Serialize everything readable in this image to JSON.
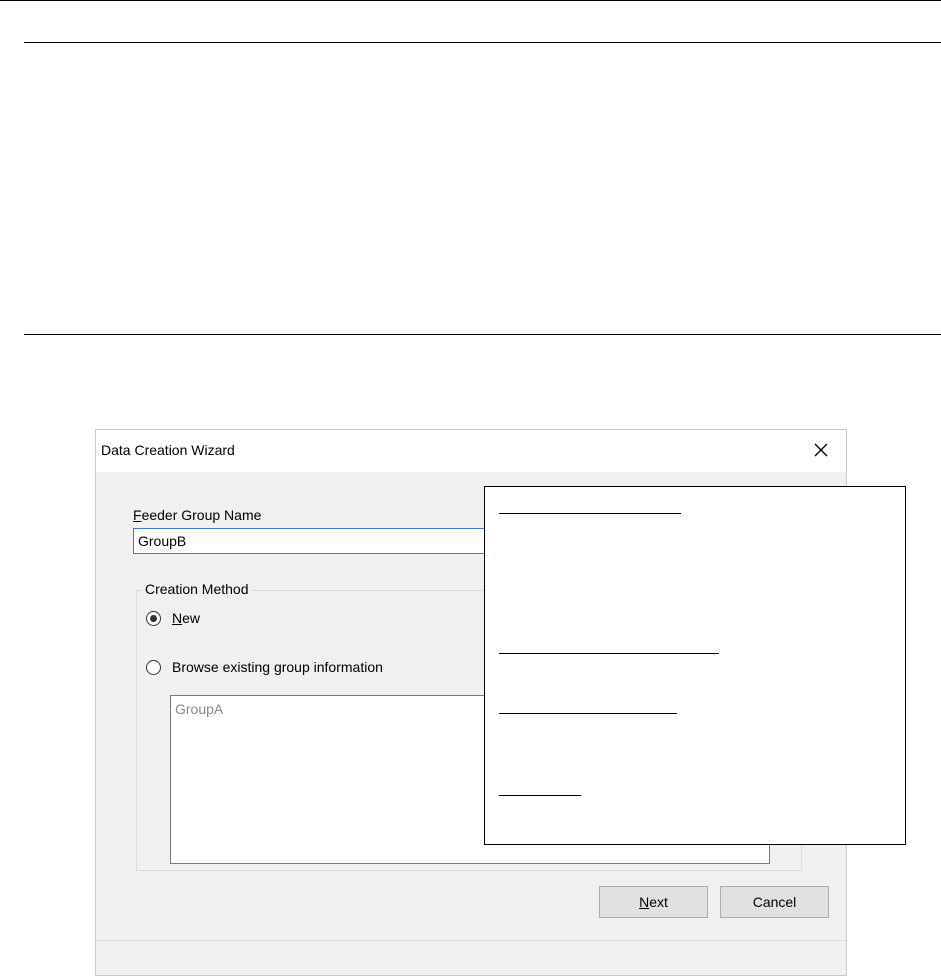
{
  "dialog": {
    "title": "Data Creation Wizard",
    "feeder_group": {
      "label_mnemonic": "F",
      "label_rest": "eeder Group Name",
      "value": "GroupB"
    },
    "creation_method": {
      "legend": "Creation Method",
      "new_mnemonic": "N",
      "new_rest": "ew",
      "new_checked": true,
      "browse_before": "Browse existing ",
      "browse_mnemonic": "g",
      "browse_after": "roup information",
      "browse_checked": false,
      "list_items": [
        "GroupA"
      ]
    },
    "buttons": {
      "next_mnemonic": "N",
      "next_rest": "ext",
      "cancel": "Cancel"
    }
  },
  "icons": {
    "close": "close-icon"
  }
}
